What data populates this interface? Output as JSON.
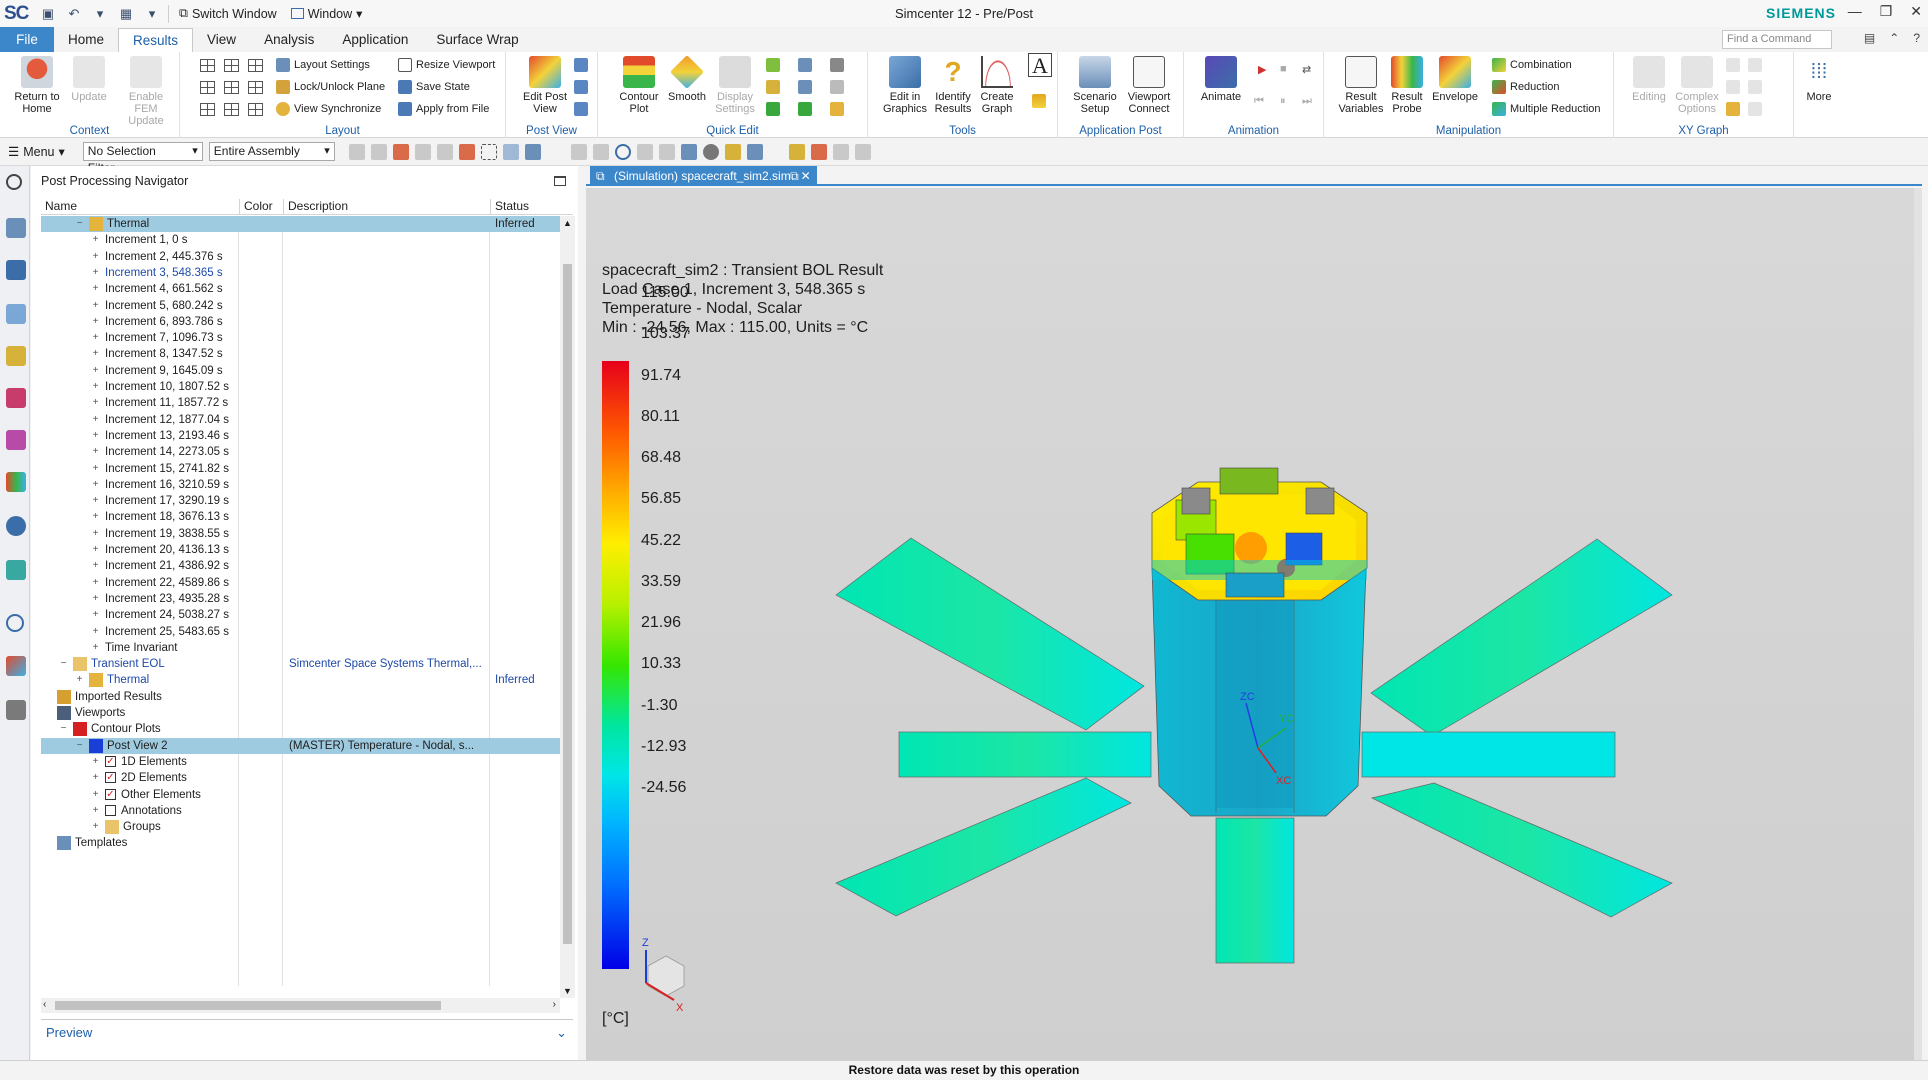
{
  "app": {
    "logo": "SC",
    "window_title": "Simcenter 12 - Pre/Post",
    "brand": "SIEMENS",
    "switch_window": "Switch Window",
    "window_menu": "Window"
  },
  "tabs": [
    "File",
    "Home",
    "Results",
    "View",
    "Analysis",
    "Application",
    "Surface Wrap"
  ],
  "active_tab": "Results",
  "command_search_placeholder": "Find a Command",
  "ribbon": {
    "context": {
      "label": "Context",
      "return_home": "Return to Home",
      "update": "Update",
      "enable_fem": "Enable FEM Update"
    },
    "layout": {
      "label": "Layout",
      "layout_settings": "Layout Settings",
      "lock_unlock": "Lock/Unlock Plane",
      "view_sync": "View Synchronize",
      "resize_viewport": "Resize Viewport",
      "save_state": "Save State",
      "apply_from_file": "Apply from File"
    },
    "post_view": {
      "label": "Post View",
      "edit_post_view": "Edit Post View"
    },
    "quick_edit": {
      "label": "Quick Edit",
      "contour_plot": "Contour Plot",
      "smooth": "Smooth",
      "display_settings": "Display Settings"
    },
    "tools": {
      "label": "Tools",
      "edit_graphics": "Edit in Graphics",
      "identify_results": "Identify Results",
      "create_graph": "Create Graph"
    },
    "application_post": {
      "label": "Application Post",
      "scenario_setup": "Scenario Setup",
      "viewport_connect": "Viewport Connect"
    },
    "animation": {
      "label": "Animation",
      "animate": "Animate"
    },
    "manipulation": {
      "label": "Manipulation",
      "result_variables": "Result Variables",
      "result_probe": "Result Probe",
      "envelope": "Envelope",
      "combination": "Combination",
      "reduction": "Reduction",
      "multiple_reduction": "Multiple Reduction"
    },
    "xy_graph": {
      "label": "XY Graph",
      "editing": "Editing",
      "complex_options": "Complex Options",
      "more": "More"
    }
  },
  "toolbar": {
    "menu": "Menu",
    "selection_filter": "No Selection Filter",
    "scope": "Entire Assembly"
  },
  "navigator": {
    "title": "Post Processing Navigator",
    "columns": {
      "name": "Name",
      "color": "Color",
      "description": "Description",
      "status": "Status"
    },
    "thermal_top": {
      "name": "Thermal",
      "status": "Inferred"
    },
    "increments": [
      "Increment 1, 0 s",
      "Increment 2, 445.376 s",
      "Increment 3, 548.365 s",
      "Increment 4, 661.562 s",
      "Increment 5, 680.242 s",
      "Increment 6, 893.786 s",
      "Increment 7, 1096.73 s",
      "Increment 8, 1347.52 s",
      "Increment 9, 1645.09 s",
      "Increment 10, 1807.52 s",
      "Increment 11, 1857.72 s",
      "Increment 12, 1877.04 s",
      "Increment 13, 2193.46 s",
      "Increment 14, 2273.05 s",
      "Increment 15, 2741.82 s",
      "Increment 16, 3210.59 s",
      "Increment 17, 3290.19 s",
      "Increment 18, 3676.13 s",
      "Increment 19, 3838.55 s",
      "Increment 20, 4136.13 s",
      "Increment 21, 4386.92 s",
      "Increment 22, 4589.86 s",
      "Increment 23, 4935.28 s",
      "Increment 24, 5038.27 s",
      "Increment 25, 5483.65 s"
    ],
    "active_increment_index": 2,
    "time_invariant": "Time Invariant",
    "transient_eol": {
      "name": "Transient EOL",
      "description": "Simcenter Space Systems Thermal,..."
    },
    "thermal_eol": {
      "name": "Thermal",
      "status": "Inferred"
    },
    "imported_results": "Imported Results",
    "viewports": "Viewports",
    "contour_plots": "Contour Plots",
    "post_view_2": {
      "name": "Post View 2",
      "description": "(MASTER) Temperature - Nodal, s..."
    },
    "elements": [
      {
        "name": "1D Elements",
        "checked": true
      },
      {
        "name": "2D Elements",
        "checked": true
      },
      {
        "name": "Other Elements",
        "checked": true
      },
      {
        "name": "Annotations",
        "checked": false
      }
    ],
    "groups": "Groups",
    "templates": "Templates",
    "preview": "Preview"
  },
  "graphics": {
    "tab_label": "(Simulation) spacecraft_sim2.sim",
    "info_lines": [
      "spacecraft_sim2 : Transient BOL Result",
      "Load Case 1, Increment 3, 548.365 s",
      "Temperature - Nodal, Scalar",
      "Min : -24.56, Max : 115.00, Units = °C"
    ],
    "legend_values": [
      "115.00",
      "103.37",
      "91.74",
      "80.11",
      "68.48",
      "56.85",
      "45.22",
      "33.59",
      "21.96",
      "10.33",
      "-1.30",
      "-12.93",
      "-24.56"
    ],
    "units": "[°C]",
    "triad": {
      "z": "Z",
      "x": "X",
      "zc": "ZC",
      "yc": "YC",
      "xc": "XC"
    }
  },
  "status_bar": "Restore data was reset by this operation"
}
